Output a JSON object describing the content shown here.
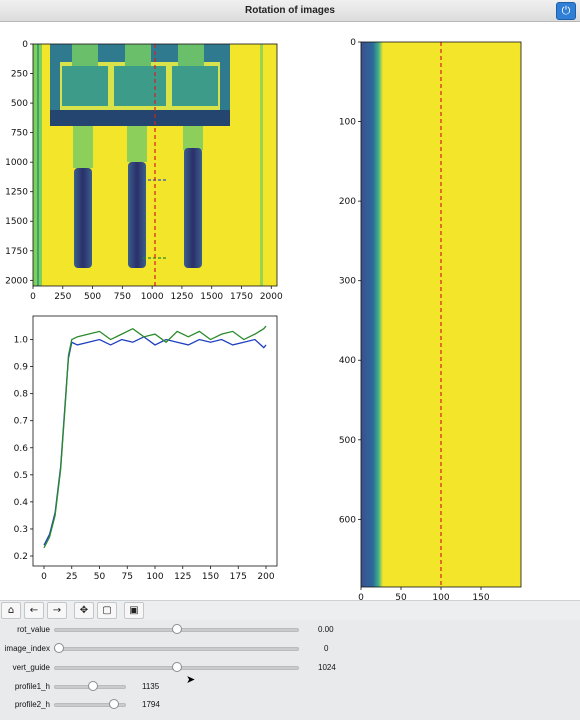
{
  "window": {
    "title": "Rotation of images"
  },
  "top_left_image": {
    "xticks": [
      "0",
      "250",
      "500",
      "750",
      "1000",
      "1250",
      "1500",
      "1750",
      "2000"
    ],
    "yticks": [
      "0",
      "250",
      "500",
      "750",
      "1000",
      "1250",
      "1500",
      "1750",
      "2000"
    ],
    "vertical_guide_x": 1024,
    "profile1_h": 1135,
    "profile2_h": 1794
  },
  "right_image": {
    "xticks": [
      "0",
      "50",
      "100",
      "150"
    ],
    "yticks": [
      "0",
      "100",
      "200",
      "300",
      "400",
      "500",
      "600"
    ],
    "vertical_guide_x": 100
  },
  "chart_data": [
    {
      "type": "line",
      "xlim": [
        0,
        200
      ],
      "ylim": [
        0.2,
        1.05
      ],
      "xticks": [
        "0",
        "25",
        "50",
        "75",
        "100",
        "125",
        "150",
        "175",
        "200"
      ],
      "yticks": [
        "0.2",
        "0.3",
        "0.4",
        "0.5",
        "0.6",
        "0.7",
        "0.8",
        "0.9",
        "1.0"
      ],
      "series": [
        {
          "color": "#1f3fbf",
          "x": [
            0,
            5,
            10,
            15,
            20,
            22,
            25,
            30,
            40,
            50,
            60,
            70,
            80,
            90,
            100,
            110,
            120,
            130,
            140,
            150,
            160,
            170,
            180,
            190,
            198,
            200
          ],
          "y": [
            0.24,
            0.28,
            0.36,
            0.53,
            0.82,
            0.93,
            0.99,
            0.98,
            0.99,
            1.0,
            0.98,
            1.0,
            0.99,
            1.01,
            0.98,
            1.0,
            0.99,
            0.98,
            1.0,
            0.99,
            1.0,
            0.98,
            0.99,
            1.0,
            0.97,
            0.98
          ]
        },
        {
          "color": "#2a8a2a",
          "x": [
            0,
            5,
            10,
            15,
            20,
            22,
            25,
            30,
            40,
            50,
            60,
            70,
            80,
            90,
            100,
            110,
            120,
            130,
            140,
            150,
            160,
            170,
            180,
            190,
            198,
            200
          ],
          "y": [
            0.23,
            0.27,
            0.35,
            0.52,
            0.81,
            0.94,
            1.0,
            1.01,
            1.02,
            1.03,
            1.0,
            1.02,
            1.04,
            1.01,
            1.02,
            0.99,
            1.03,
            1.01,
            1.03,
            1.0,
            1.02,
            1.03,
            1.0,
            1.02,
            1.04,
            1.05
          ]
        }
      ]
    }
  ],
  "toolbar": {
    "home_icon": "home-icon",
    "back_icon": "arrow-left-icon",
    "forward_icon": "arrow-right-icon",
    "pan_icon": "move-icon",
    "zoom_icon": "zoom-rect-icon",
    "save_icon": "save-icon"
  },
  "sliders": [
    {
      "label": "rot_value",
      "value": "0.00",
      "fraction": 0.5
    },
    {
      "label": "image_index",
      "value": "0",
      "fraction": 0.0
    },
    {
      "label": "vert_guide",
      "value": "1024",
      "fraction": 0.5
    },
    {
      "label": "profile1_h",
      "value": "1135",
      "fraction": 0.55
    },
    {
      "label": "profile2_h",
      "value": "1794",
      "fraction": 0.88
    }
  ]
}
